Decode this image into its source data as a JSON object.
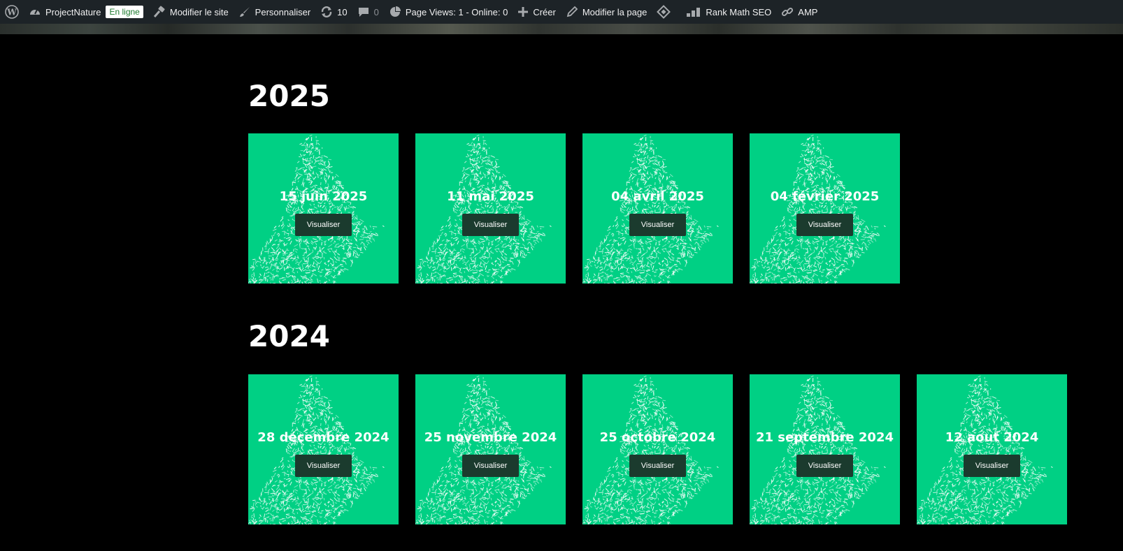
{
  "adminbar": {
    "site_name": "ProjectNature",
    "status_badge": "En ligne",
    "edit_site": "Modifier le site",
    "customize": "Personnaliser",
    "updates_count": "10",
    "comments_count": "0",
    "page_views": "Page Views: 1 - Online: 0",
    "new": "Créer",
    "edit_page": "Modifier la page",
    "rank_math": "Rank Math SEO",
    "amp": "AMP"
  },
  "colors": {
    "card_green": "#00d084",
    "button_dark": "#1b3b2e",
    "adminbar_bg": "#1d2327"
  },
  "years": [
    {
      "year": "2025",
      "cards": [
        {
          "date": "15 juin 2025",
          "button": "Visualiser"
        },
        {
          "date": "11 mai 2025",
          "button": "Visualiser"
        },
        {
          "date": "04 avril 2025",
          "button": "Visualiser"
        },
        {
          "date": "04 février 2025",
          "button": "Visualiser"
        }
      ]
    },
    {
      "year": "2024",
      "cards": [
        {
          "date": "28 décembre 2024",
          "button": "Visualiser"
        },
        {
          "date": "25 novembre 2024",
          "button": "Visualiser"
        },
        {
          "date": "25 octobre 2024",
          "button": "Visualiser"
        },
        {
          "date": "21 septembre 2024",
          "button": "Visualiser"
        },
        {
          "date": "12 aout 2024",
          "button": "Visualiser"
        }
      ]
    }
  ]
}
